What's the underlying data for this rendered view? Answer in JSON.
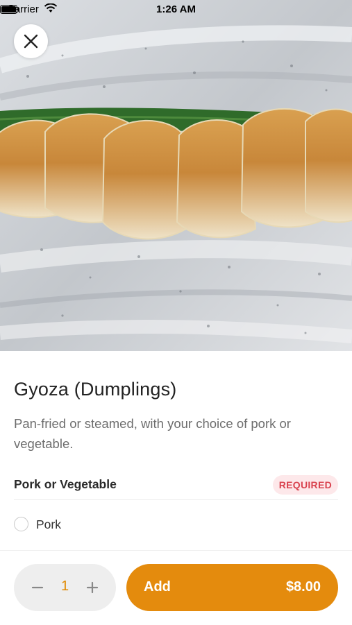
{
  "status_bar": {
    "carrier": "Carrier",
    "time": "1:26 AM"
  },
  "item": {
    "title": "Gyoza (Dumplings)",
    "description": "Pan-fried or steamed, with your choice of pork or vegetable."
  },
  "options": {
    "header": "Pork or Vegetable",
    "required_label": "REQUIRED",
    "choices": [
      {
        "label": "Pork",
        "selected": false
      }
    ]
  },
  "footer": {
    "quantity": "1",
    "add_label": "Add",
    "price": "$8.00"
  },
  "colors": {
    "accent": "#e48b0d",
    "required_text": "#d9434f",
    "required_bg": "#fde8ea"
  },
  "icons": {
    "close": "close-icon",
    "minus": "minus-icon",
    "plus": "plus-icon"
  }
}
